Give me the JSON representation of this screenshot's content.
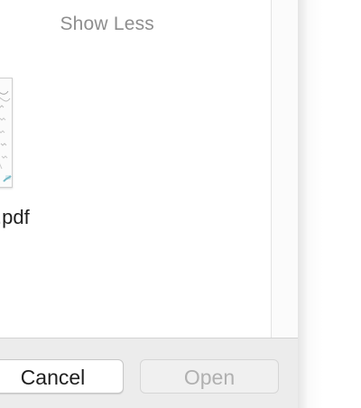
{
  "header": {
    "show_less_label": "Show Less"
  },
  "file": {
    "name": ".pdf",
    "icon": "pdf-document-thumbnail"
  },
  "footer": {
    "cancel_label": "Cancel",
    "open_label": "Open",
    "open_enabled": false
  }
}
